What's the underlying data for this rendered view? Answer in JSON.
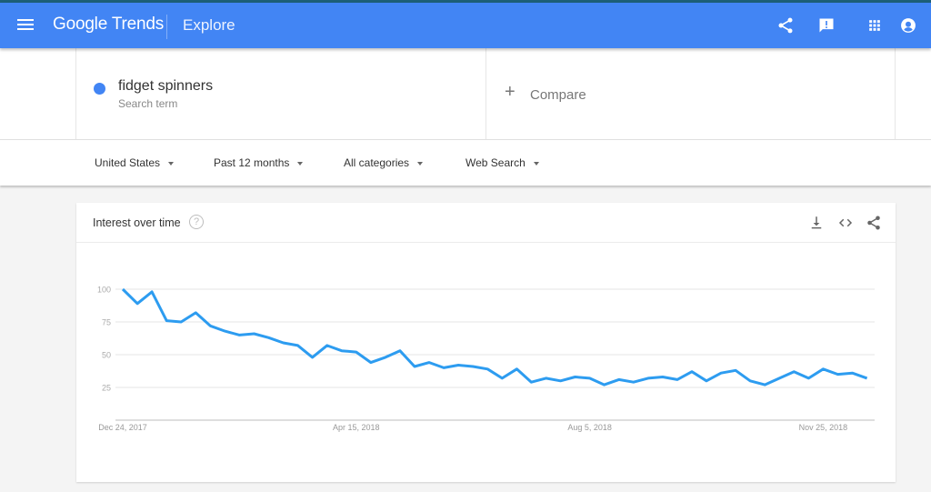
{
  "app": {
    "brand_google": "Google",
    "brand_product": "Trends",
    "page": "Explore",
    "icons": [
      "menu-icon",
      "share-icon",
      "feedback-icon",
      "apps-grid-icon",
      "account-icon"
    ]
  },
  "search": {
    "term": "fidget spinners",
    "term_type": "Search term",
    "term_color": "#4285f4",
    "compare_label": "Compare"
  },
  "filters": {
    "region": "United States",
    "time_range": "Past 12 months",
    "category": "All categories",
    "search_type": "Web Search"
  },
  "card": {
    "title": "Interest over time",
    "help": "?",
    "actions": [
      "download-icon",
      "embed-icon",
      "share-icon"
    ]
  },
  "chart_data": {
    "type": "line",
    "title": "Interest over time",
    "xlabel": "",
    "ylabel": "",
    "ylim": [
      0,
      100
    ],
    "yticks": [
      25,
      50,
      75,
      100
    ],
    "xtick_labels": [
      "Dec 24, 2017",
      "Apr 15, 2018",
      "Aug 5, 2018",
      "Nov 25, 2018"
    ],
    "xtick_indices": [
      0,
      16,
      32,
      48
    ],
    "grid": true,
    "series": [
      {
        "name": "fidget spinners",
        "color": "#2d9cf0",
        "x_start": "Dec 24, 2017",
        "x_interval": "weekly",
        "values": [
          100,
          89,
          98,
          76,
          75,
          82,
          72,
          68,
          65,
          66,
          63,
          59,
          57,
          48,
          57,
          53,
          52,
          44,
          48,
          53,
          41,
          44,
          40,
          42,
          41,
          39,
          32,
          39,
          29,
          32,
          30,
          33,
          32,
          27,
          31,
          29,
          32,
          33,
          31,
          37,
          30,
          36,
          38,
          30,
          27,
          32,
          37,
          32,
          39,
          35,
          36,
          32
        ]
      }
    ]
  }
}
